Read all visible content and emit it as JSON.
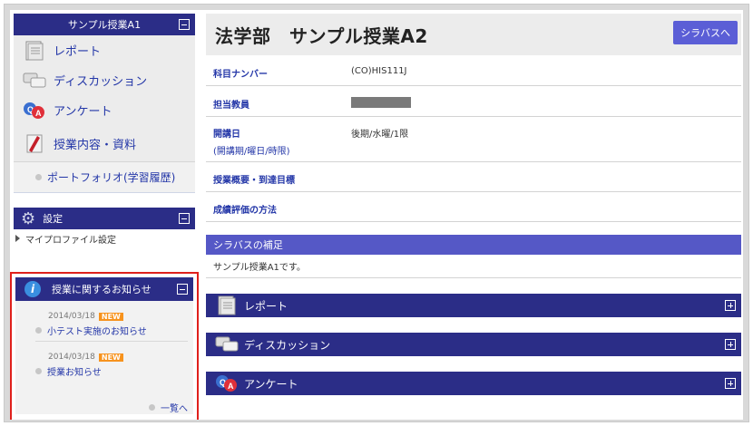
{
  "sidebar": {
    "course_header": "サンプル授業A1",
    "menu": [
      {
        "label": "レポート",
        "icon": "report-icon"
      },
      {
        "label": "ディスカッション",
        "icon": "discussion-icon"
      },
      {
        "label": "アンケート",
        "icon": "survey-qa-icon"
      },
      {
        "label": "授業内容・資料",
        "icon": "materials-icon"
      }
    ],
    "portfolio_label": "ポートフォリオ(学習履歴)",
    "settings_header": "設定",
    "my_profile_label": "マイプロファイル設定",
    "notice_header": "授業に関するお知らせ",
    "notices": [
      {
        "date": "2014/03/18",
        "badge": "NEW",
        "title": "小テスト実施のお知らせ"
      },
      {
        "date": "2014/03/18",
        "badge": "NEW",
        "title": "授業お知らせ"
      }
    ],
    "more_link": "一覧へ"
  },
  "main": {
    "title": "法学部　サンプル授業A2",
    "syllabus_button": "シラバスへ",
    "info_rows": [
      {
        "label": "科目ナンバー",
        "value": "(CO)HIS111J"
      },
      {
        "label": "担当教員",
        "value": ""
      },
      {
        "label": "開講日",
        "sublabel": "(開講期/曜日/時限)",
        "value": "後期/水曜/1限"
      },
      {
        "label": "授業概要・到達目標",
        "value": ""
      },
      {
        "label": "成績評価の方法",
        "value": ""
      }
    ],
    "supplement_header": "シラバスの補足",
    "supplement_text": "サンプル授業A1です。",
    "sections": [
      {
        "label": "レポート",
        "icon": "report-icon"
      },
      {
        "label": "ディスカッション",
        "icon": "discussion-icon"
      },
      {
        "label": "アンケート",
        "icon": "survey-qa-icon"
      }
    ]
  },
  "colors": {
    "nav_dark": "#2b2d87",
    "accent": "#5b5ed6",
    "highlight": "#e0201c",
    "badge": "#f7931e",
    "link": "#2437a8"
  }
}
